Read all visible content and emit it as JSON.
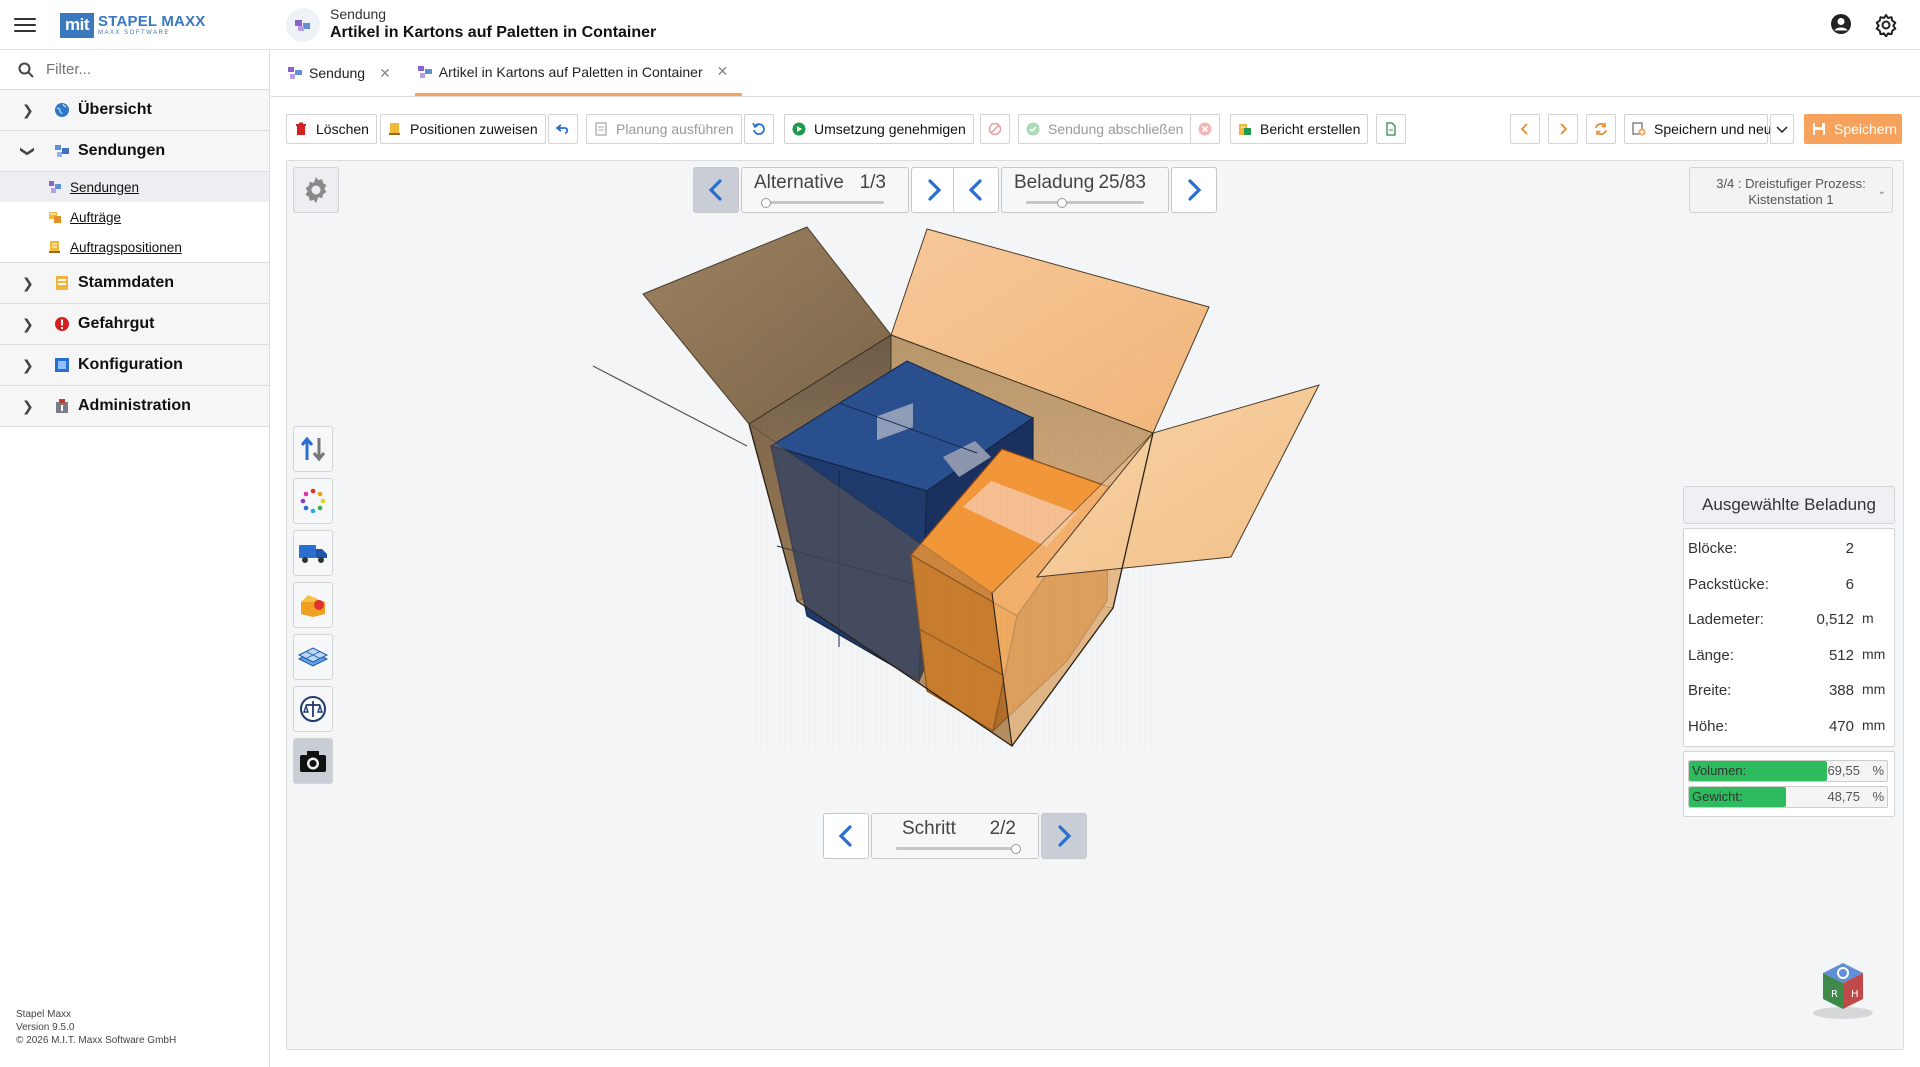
{
  "header": {
    "logo_mark": "mit",
    "logo_name": "STAPEL MAXX",
    "logo_sub": "MAXX SOFTWARE",
    "context_label": "Sendung",
    "title": "Artikel in Kartons auf Paletten in Container"
  },
  "sidebar": {
    "filter_placeholder": "Filter...",
    "items": [
      {
        "label": "Übersicht",
        "icon": "globe-icon",
        "expanded": false
      },
      {
        "label": "Sendungen",
        "icon": "shipments-icon",
        "expanded": true,
        "children": [
          {
            "label": "Sendungen",
            "icon": "shipments-icon",
            "active": true
          },
          {
            "label": "Aufträge",
            "icon": "orders-icon",
            "active": false
          },
          {
            "label": "Auftragspositionen",
            "icon": "order-positions-icon",
            "active": false
          }
        ]
      },
      {
        "label": "Stammdaten",
        "icon": "master-data-icon",
        "expanded": false
      },
      {
        "label": "Gefahrgut",
        "icon": "dangerous-goods-icon",
        "expanded": false
      },
      {
        "label": "Konfiguration",
        "icon": "configuration-icon",
        "expanded": false
      },
      {
        "label": "Administration",
        "icon": "administration-icon",
        "expanded": false
      }
    ],
    "footer": {
      "product": "Stapel Maxx",
      "version": "Version 9.5.0",
      "copyright": "© 2026 M.I.T. Maxx Software GmbH"
    }
  },
  "tabs": [
    {
      "label": "Sendung",
      "active": false
    },
    {
      "label": "Artikel in Kartons auf Paletten in Container",
      "active": true
    }
  ],
  "toolbar": {
    "delete": "Löschen",
    "assign_positions": "Positionen zuweisen",
    "run_planning": "Planung ausführen",
    "approve": "Umsetzung genehmigen",
    "complete": "Sendung abschließen",
    "report": "Bericht erstellen",
    "save_and_new": "Speichern und neu",
    "save": "Speichern"
  },
  "viewer": {
    "alternative": {
      "label": "Alternative",
      "value": "1/3",
      "position": 0.0
    },
    "loading": {
      "label": "Beladung",
      "value": "25/83",
      "position": 0.3
    },
    "step": {
      "label": "Schritt",
      "value": "2/2",
      "position": 1.0
    },
    "process": {
      "line1": "3/4 : Dreistufiger Prozess:",
      "line2": "Kistenstation 1"
    },
    "side_tools": [
      "sort-arrows-icon",
      "color-dots-icon",
      "truck-icon",
      "open-box-icon",
      "layer-grid-icon",
      "scale-icon",
      "camera-icon"
    ]
  },
  "selected_loading": {
    "title": "Ausgewählte Beladung",
    "rows": [
      {
        "label": "Blöcke:",
        "value": "2",
        "unit": ""
      },
      {
        "label": "Packstücke:",
        "value": "6",
        "unit": ""
      },
      {
        "label": "Lademeter:",
        "value": "0,512",
        "unit": "m"
      },
      {
        "label": "Länge:",
        "value": "512",
        "unit": "mm"
      },
      {
        "label": "Breite:",
        "value": "388",
        "unit": "mm"
      },
      {
        "label": "Höhe:",
        "value": "470",
        "unit": "mm"
      }
    ],
    "bars": [
      {
        "label": "Volumen:",
        "value": "69,55",
        "unit": "%",
        "fraction": 0.6955
      },
      {
        "label": "Gewicht:",
        "value": "48,75",
        "unit": "%",
        "fraction": 0.4875
      }
    ]
  },
  "colors": {
    "accent": "#f6a25c",
    "brand": "#3a79bd",
    "progress": "#2dbb5d",
    "box_blue": "#1e3c6e",
    "box_orange": "#e98a25",
    "carton": "#f3c58e"
  }
}
